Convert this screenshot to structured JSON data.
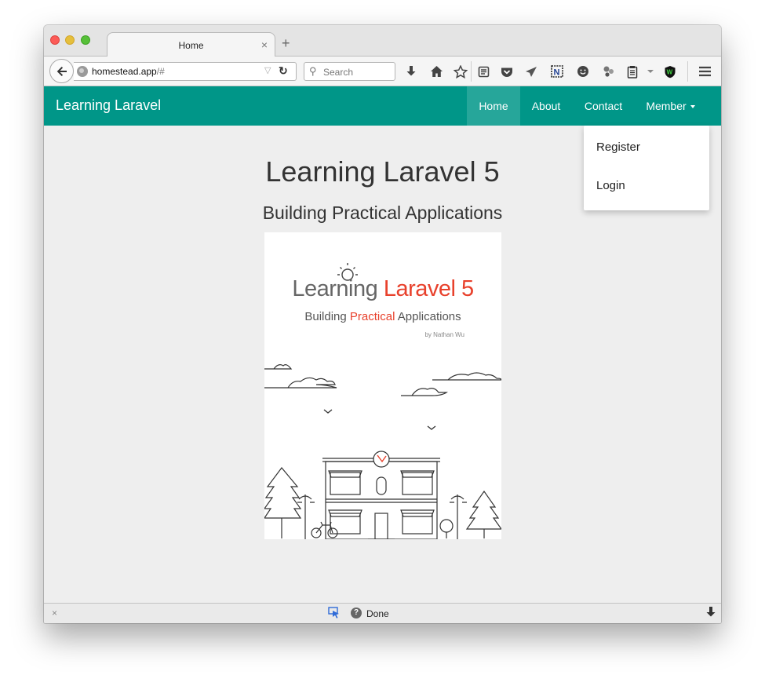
{
  "browser": {
    "tab": {
      "title": "Home",
      "close_glyph": "×",
      "new_tab_glyph": "+"
    },
    "url": {
      "host": "homestead.app",
      "path": "/#"
    },
    "search": {
      "placeholder": "Search"
    },
    "toolbar_icons": [
      "download-icon",
      "home-icon",
      "bookmark-star-icon",
      "reading-list-icon",
      "pocket-icon",
      "send-icon",
      "onenote-icon",
      "emoji-icon",
      "extension-icon",
      "clipboard-icon",
      "shield-w-icon",
      "menu-icon"
    ]
  },
  "navbar": {
    "brand": "Learning Laravel",
    "items": [
      {
        "label": "Home",
        "active": true
      },
      {
        "label": "About"
      },
      {
        "label": "Contact"
      },
      {
        "label": "Member"
      }
    ],
    "dropdown": [
      {
        "label": "Register"
      },
      {
        "label": "Login"
      }
    ],
    "color": "#009688",
    "active_color": "#26a69a"
  },
  "main": {
    "title": "Learning Laravel 5",
    "subtitle": "Building Practical Applications"
  },
  "cover": {
    "title_plain": "Learning ",
    "title_accent": "Laravel 5",
    "sub_before": "Building ",
    "sub_accent": "Practical",
    "sub_after": " Applications",
    "author": "by Nathan Wu",
    "accent_color": "#e8412c"
  },
  "statusbar": {
    "status": "Done",
    "close_glyph": "×",
    "help_glyph": "?"
  }
}
